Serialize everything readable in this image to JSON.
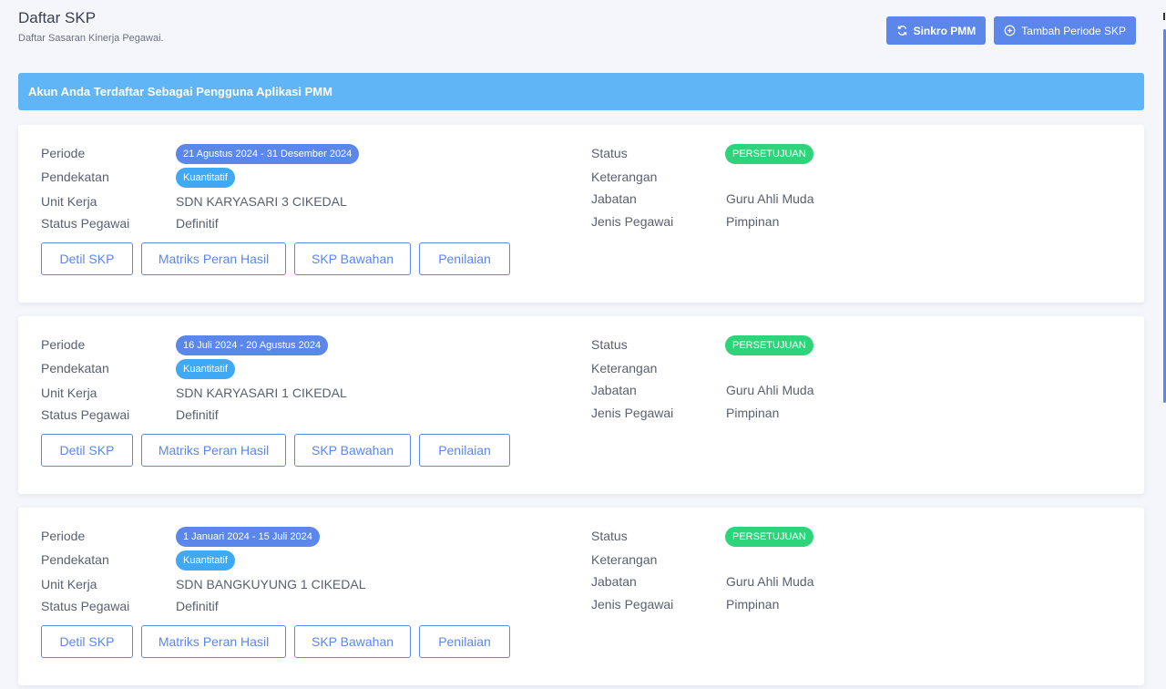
{
  "header": {
    "title": "Daftar SKP",
    "subtitle": "Daftar Sasaran Kinerja Pegawai.",
    "sync_label": "Sinkro PMM",
    "add_label": "Tambah Periode SKP"
  },
  "alert": {
    "text": "Akun Anda Terdaftar Sebagai Pengguna Aplikasi PMM"
  },
  "labels": {
    "periode": "Periode",
    "pendekatan": "Pendekatan",
    "unit_kerja": "Unit Kerja",
    "status_pegawai": "Status Pegawai",
    "status": "Status",
    "keterangan": "Keterangan",
    "jabatan": "Jabatan",
    "jenis_pegawai": "Jenis Pegawai"
  },
  "actions": {
    "detil": "Detil SKP",
    "matriks": "Matriks Peran Hasil",
    "bawahan": "SKP Bawahan",
    "penilaian": "Penilaian"
  },
  "cards": [
    {
      "periode": "21 Agustus 2024 - 31 Desember 2024",
      "pendekatan": "Kuantitatif",
      "unit_kerja": "SDN KARYASARI 3 CIKEDAL",
      "status_pegawai": "Definitif",
      "status": "PERSETUJUAN",
      "keterangan": "",
      "jabatan": "Guru Ahli Muda",
      "jenis_pegawai": "Pimpinan"
    },
    {
      "periode": "16 Juli 2024 - 20 Agustus 2024",
      "pendekatan": "Kuantitatif",
      "unit_kerja": "SDN KARYASARI 1 CIKEDAL",
      "status_pegawai": "Definitif",
      "status": "PERSETUJUAN",
      "keterangan": "",
      "jabatan": "Guru Ahli Muda",
      "jenis_pegawai": "Pimpinan"
    },
    {
      "periode": "1 Januari 2024 - 15 Juli 2024",
      "pendekatan": "Kuantitatif",
      "unit_kerja": "SDN BANGKUYUNG 1 CIKEDAL",
      "status_pegawai": "Definitif",
      "status": "PERSETUJUAN",
      "keterangan": "",
      "jabatan": "Guru Ahli Muda",
      "jenis_pegawai": "Pimpinan"
    }
  ],
  "colors": {
    "primary": "#5b87ea",
    "alert": "#5fb5f5",
    "approach": "#3fa9f5",
    "status_ok": "#2ed47a"
  }
}
